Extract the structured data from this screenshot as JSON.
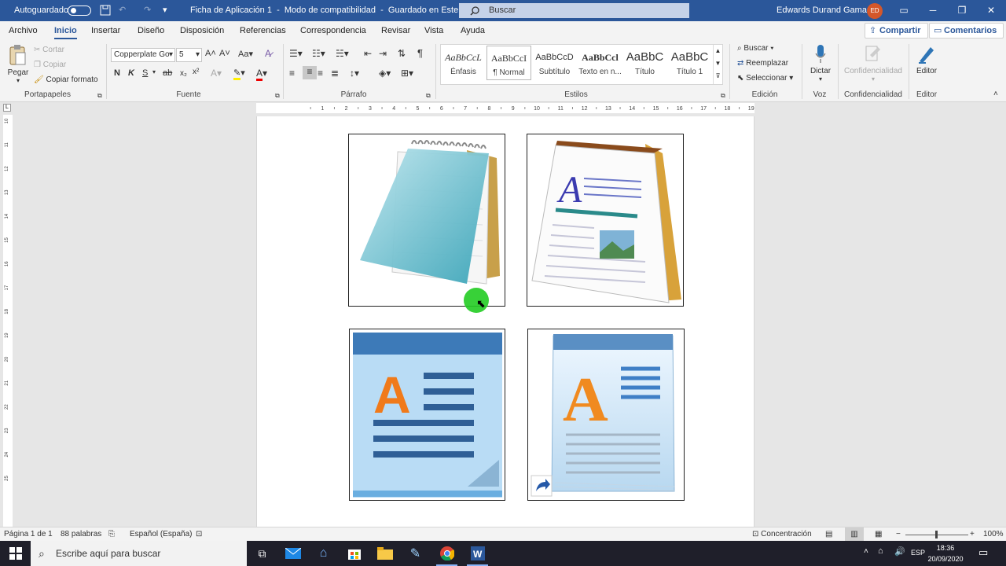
{
  "titlebar": {
    "autosave_label": "Autoguardado",
    "doc_title": "Ficha de Aplicación 1",
    "mode": "Modo de compatibilidad",
    "saved": "Guardado en Este PC",
    "search_placeholder": "Buscar",
    "user_name": "Edwards Durand Gamarra",
    "user_initials": "ED"
  },
  "menu": {
    "tabs": [
      "Archivo",
      "Inicio",
      "Insertar",
      "Diseño",
      "Disposición",
      "Referencias",
      "Correspondencia",
      "Revisar",
      "Vista",
      "Ayuda"
    ],
    "active_tab": "Inicio",
    "share_label": "Compartir",
    "comments_label": "Comentarios"
  },
  "ribbon": {
    "clipboard": {
      "paste": "Pegar",
      "cut": "Cortar",
      "copy": "Copiar",
      "format_painter": "Copiar formato",
      "label": "Portapapeles"
    },
    "font": {
      "name": "Copperplate Go",
      "size": "5",
      "bold": "N",
      "italic": "K",
      "underline": "S",
      "strike": "ab",
      "label": "Fuente"
    },
    "paragraph": {
      "label": "Párrafo"
    },
    "styles": {
      "items": [
        {
          "sample": "AaBbCcL",
          "name": "Énfasis"
        },
        {
          "sample": "AaBbCcI",
          "name": "¶ Normal"
        },
        {
          "sample": "AaBbCcD",
          "name": "Subtítulo"
        },
        {
          "sample": "AaBbCcl",
          "name": "Texto en n..."
        },
        {
          "sample": "AaBbC",
          "name": "Título"
        },
        {
          "sample": "AaBbC",
          "name": "Título 1"
        }
      ],
      "label": "Estilos"
    },
    "editing": {
      "find": "Buscar",
      "replace": "Reemplazar",
      "select": "Seleccionar",
      "label": "Edición"
    },
    "voice": {
      "dictate": "Dictar",
      "label": "Voz"
    },
    "sensitivity": {
      "button": "Confidencialidad",
      "label": "Confidencialidad"
    },
    "editor": {
      "button": "Editor",
      "label": "Editor"
    }
  },
  "ruler": {
    "h_labels": [
      "1",
      "2",
      "3",
      "4",
      "5",
      "6",
      "7",
      "8",
      "9",
      "10",
      "11",
      "12",
      "13",
      "14",
      "15",
      "16",
      "17",
      "18",
      "19"
    ],
    "v_labels": [
      "10",
      "11",
      "12",
      "13",
      "14",
      "15",
      "16",
      "17",
      "18",
      "19",
      "20",
      "21",
      "22",
      "23",
      "24",
      "25"
    ]
  },
  "statusbar": {
    "page": "Página 1 de 1",
    "words": "88 palabras",
    "language": "Español (España)",
    "focus": "Concentración",
    "zoom": "100%"
  },
  "taskbar": {
    "search_placeholder": "Escribe aquí para buscar",
    "lang": "ESP",
    "time": "18:36",
    "date": "20/09/2020"
  },
  "colors": {
    "word_blue": "#2b579a",
    "taskbar": "#1f1f2a"
  }
}
